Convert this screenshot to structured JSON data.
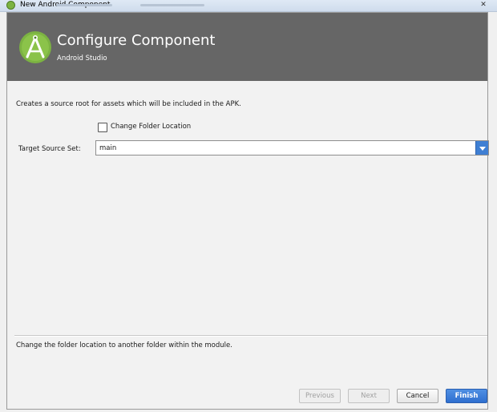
{
  "window": {
    "title": "New Android Component",
    "close_glyph": "✕"
  },
  "header": {
    "title": "Configure Component",
    "subtitle": "Android Studio",
    "icon": "android-studio-logo",
    "background": "#666666"
  },
  "form": {
    "description": "Creates a source root for assets which will be included in the APK.",
    "change_folder_checkbox": {
      "label": "Change Folder Location",
      "checked": false
    },
    "target_source_set": {
      "label": "Target Source Set:",
      "value": "main"
    },
    "help_text": "Change the folder location to another folder within the module."
  },
  "buttons": {
    "previous": "Previous",
    "next": "Next",
    "cancel": "Cancel",
    "finish": "Finish"
  },
  "colors": {
    "accent": "#3f7fd3",
    "primary_button": "#2f6fcf",
    "android_green": "#7cb342"
  }
}
